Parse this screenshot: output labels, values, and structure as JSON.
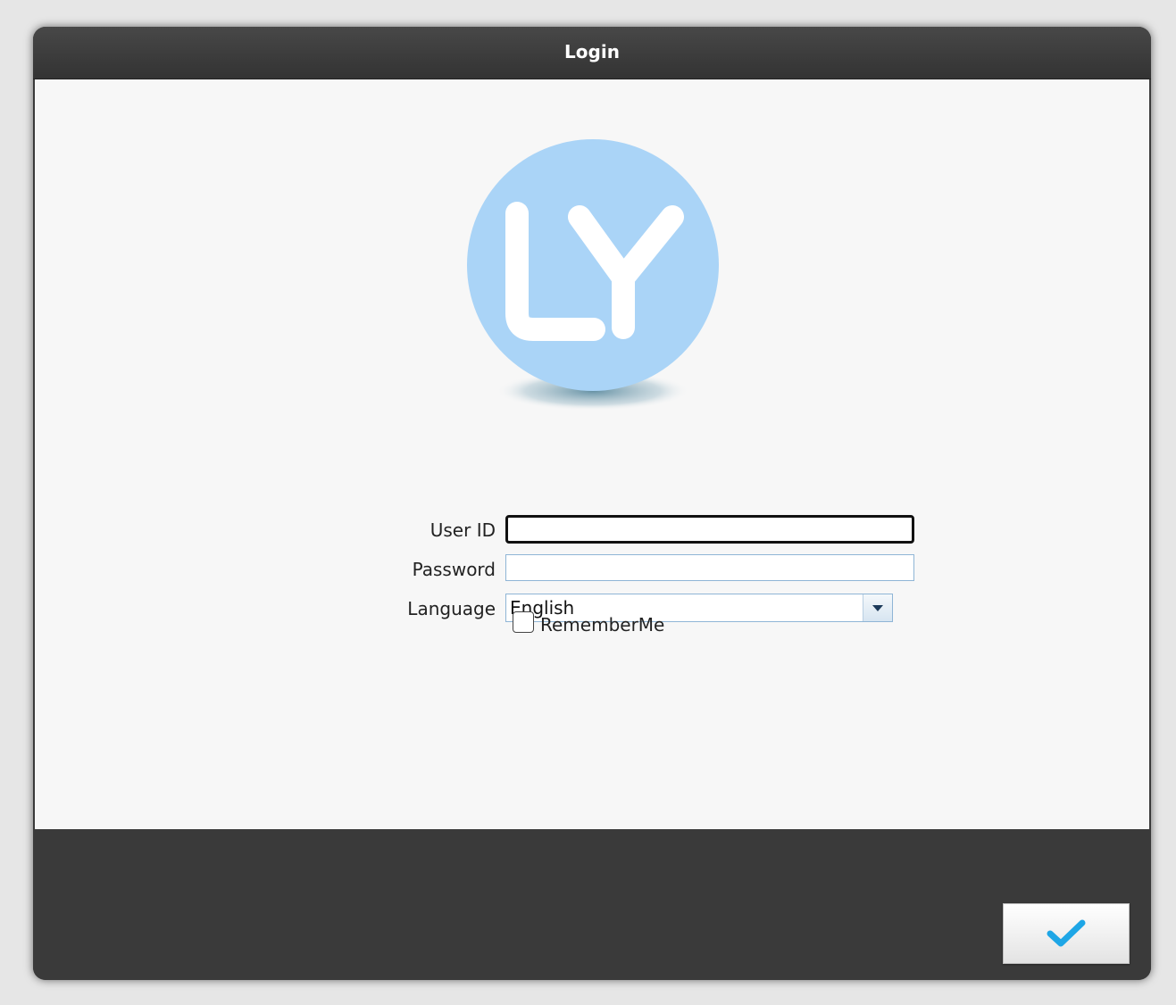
{
  "window": {
    "title": "Login"
  },
  "logo": {
    "icon": "ly-logo-icon",
    "color": "#aad4f7"
  },
  "form": {
    "user_id": {
      "label": "User ID",
      "value": "",
      "placeholder": ""
    },
    "password": {
      "label": "Password",
      "value": "",
      "placeholder": ""
    },
    "language": {
      "label": "Language",
      "selected": "English"
    },
    "remember_me": {
      "label": "RememberMe",
      "checked": false
    }
  },
  "footer": {
    "ok_icon": "checkmark-icon",
    "ok_icon_color": "#1ea6e6"
  }
}
